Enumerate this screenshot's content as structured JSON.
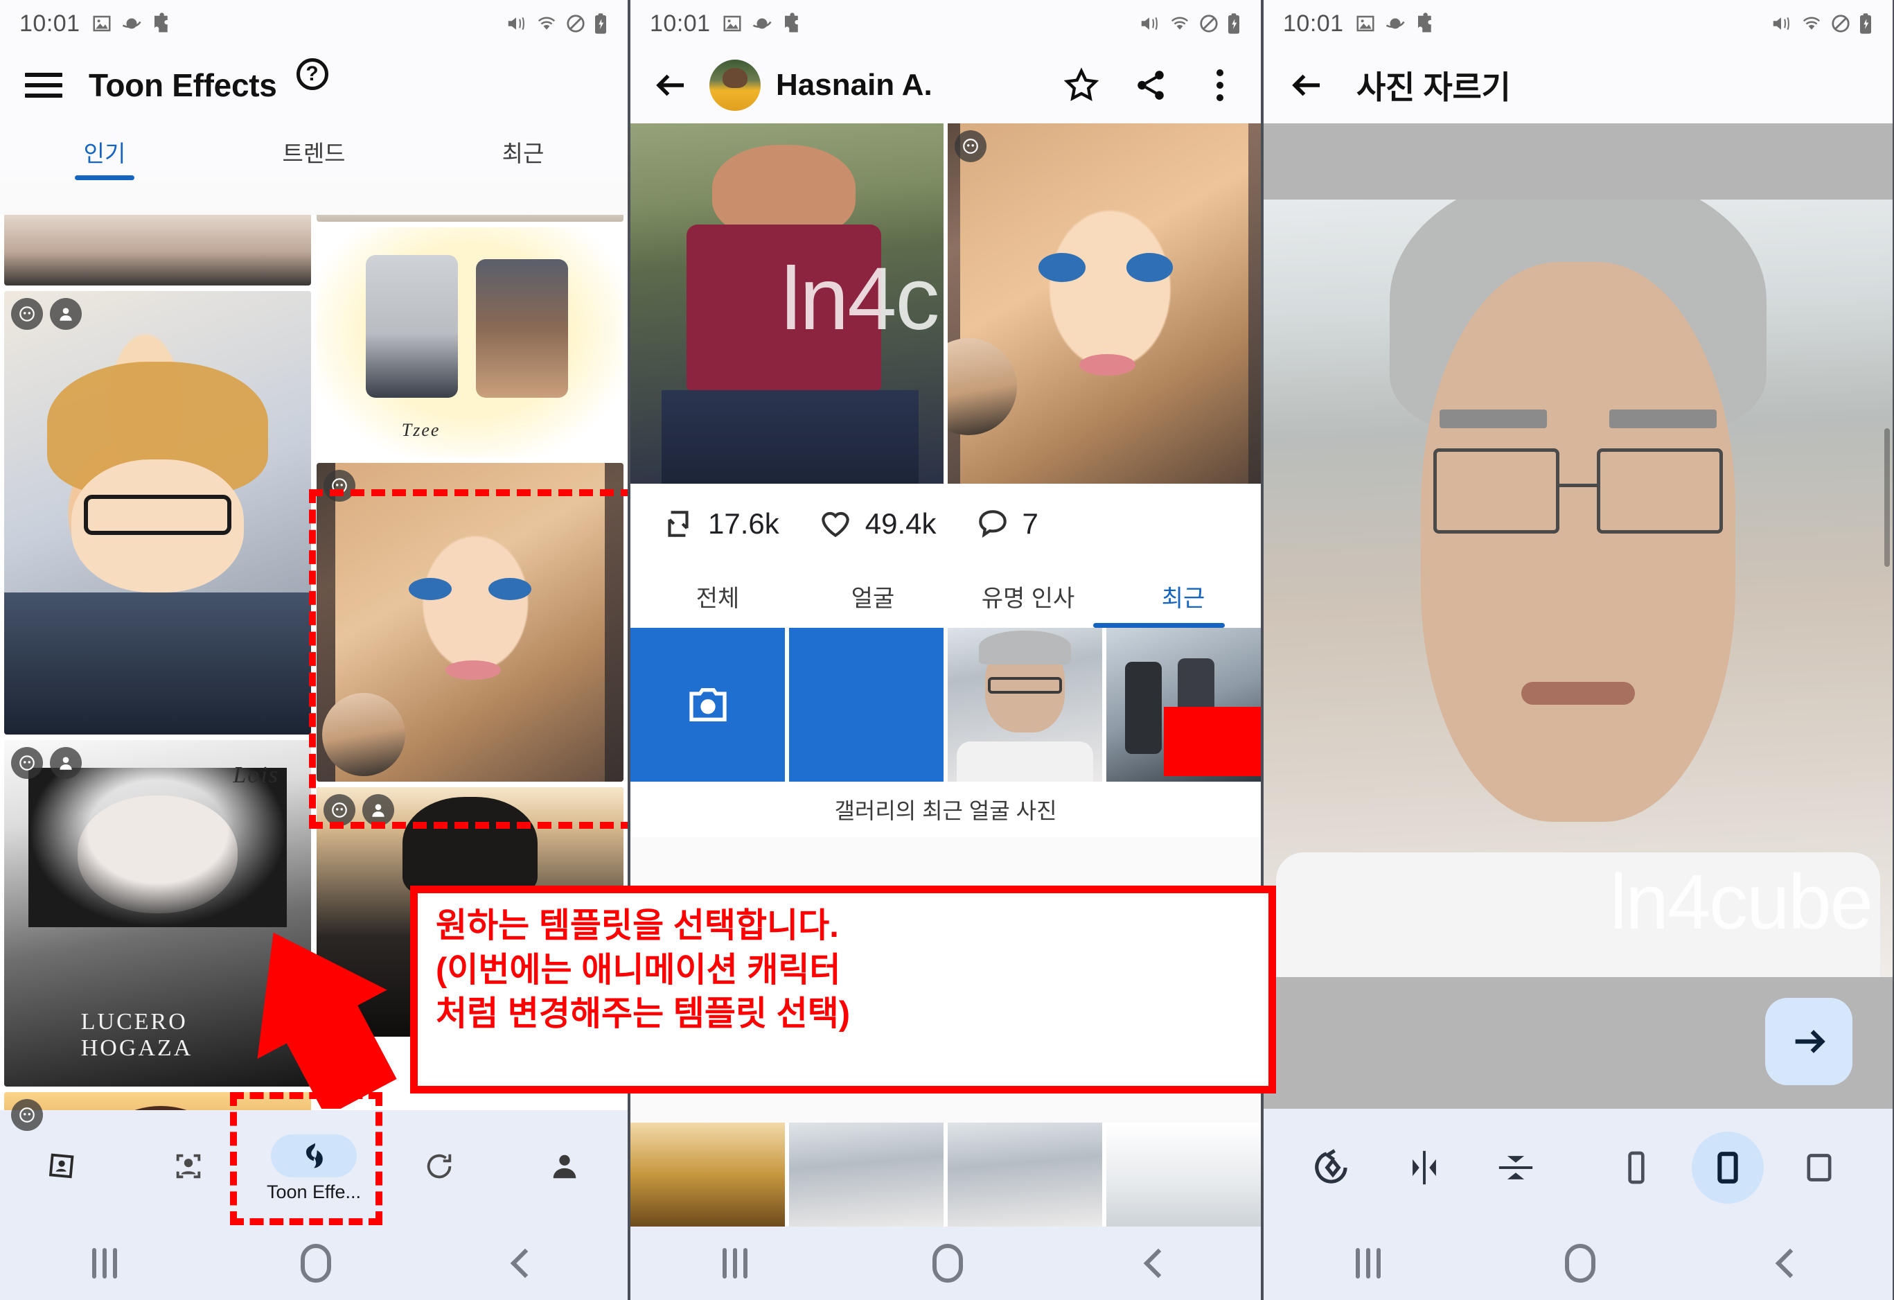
{
  "meta": {
    "time": "10:01",
    "watermark": "ln4cube"
  },
  "panel1": {
    "app_title": "Toon Effects",
    "icons": {
      "menu": "hamburger-icon",
      "help": "help-circle-icon"
    },
    "tabs": [
      {
        "label": "인기",
        "active": true
      },
      {
        "label": "트렌드",
        "active": false
      },
      {
        "label": "최근",
        "active": false
      }
    ],
    "cards": [
      {
        "name": "pop-art-portrait",
        "label": ""
      },
      {
        "name": "couple-illustration",
        "label": "Tzee"
      },
      {
        "name": "toon-girl-template",
        "label": "",
        "highlighted": true
      },
      {
        "name": "bw-lucero-portrait",
        "label": "LUCERO HOGAZA"
      },
      {
        "name": "lois-sketch",
        "label": "Lois"
      },
      {
        "name": "dark-portrait",
        "label": ""
      },
      {
        "name": "warm-portrait",
        "label": ""
      }
    ],
    "bottom_nav": [
      {
        "label": "",
        "icon": "photo-frame-icon",
        "selected": false
      },
      {
        "label": "",
        "icon": "face-scan-icon",
        "selected": false
      },
      {
        "label": "Toon Effe...",
        "icon": "flame-icon",
        "selected": true
      },
      {
        "label": "",
        "icon": "refresh-icon",
        "selected": false
      },
      {
        "label": "",
        "icon": "person-icon",
        "selected": false
      }
    ],
    "annotation": {
      "lines": [
        "원하는 템플릿을 선택합니다.",
        "(이번에는 애니메이션 캐릭터",
        "처럼 변경해주는 템플릿 선택)"
      ],
      "color": "#ff0000"
    }
  },
  "panel2": {
    "author": "Hasnain A.",
    "actions": [
      {
        "name": "favorite-star",
        "icon": "star-icon"
      },
      {
        "name": "share",
        "icon": "share-icon"
      },
      {
        "name": "overflow-menu",
        "icon": "more-vertical-icon"
      }
    ],
    "stats": [
      {
        "icon": "repost-icon",
        "value": "17.6k"
      },
      {
        "icon": "heart-icon",
        "value": "49.4k"
      },
      {
        "icon": "comment-icon",
        "value": "7"
      }
    ],
    "tabs": [
      {
        "label": "전체",
        "active": false
      },
      {
        "label": "얼굴",
        "active": false
      },
      {
        "label": "유명 인사",
        "active": false
      },
      {
        "label": "최근",
        "active": true
      }
    ],
    "gallery_caption": "갤러리의 최근 얼굴 사진",
    "gallery": [
      {
        "name": "camera-tile",
        "icon": "camera-icon"
      },
      {
        "name": "blue-tile",
        "icon": ""
      },
      {
        "name": "man-glasses-photo",
        "icon": "",
        "highlighted": true
      },
      {
        "name": "crowd-photo",
        "icon": ""
      }
    ]
  },
  "panel3": {
    "app_title": "사진 자르기",
    "back_icon": "arrow-left-icon",
    "next_icon": "arrow-right-icon",
    "tools": [
      {
        "name": "rotate-button",
        "icon": "rotate-icon",
        "selected": false
      },
      {
        "name": "flip-horizontal-button",
        "icon": "flip-horizontal-icon",
        "selected": false
      },
      {
        "name": "flip-vertical-button",
        "icon": "flip-vertical-icon",
        "selected": false
      },
      {
        "name": "aspect-tall-button",
        "icon": "rect-tall-icon",
        "selected": false
      },
      {
        "name": "aspect-portrait-button",
        "icon": "rect-portrait-icon",
        "selected": true
      },
      {
        "name": "aspect-square-button",
        "icon": "rect-square-icon",
        "selected": false
      }
    ]
  },
  "android_nav": [
    {
      "name": "recents-button",
      "icon": "recents-icon"
    },
    {
      "name": "home-button",
      "icon": "home-icon"
    },
    {
      "name": "back-button",
      "icon": "back-icon"
    }
  ]
}
